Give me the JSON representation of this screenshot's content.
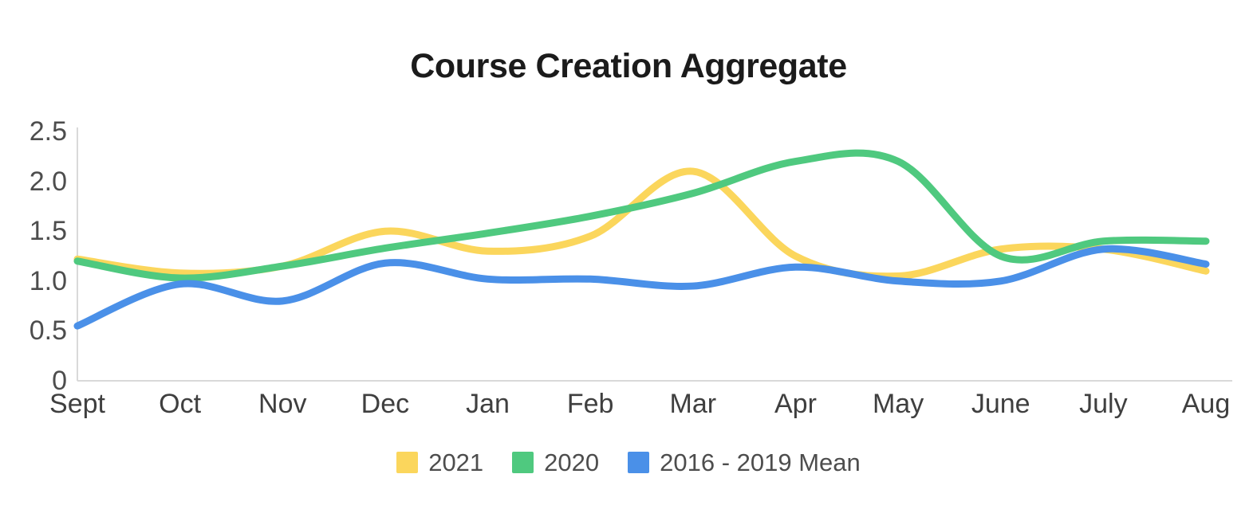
{
  "chart": {
    "title": "Course Creation Aggregate"
  },
  "legend": {
    "items": [
      {
        "label": "2021",
        "color": "#FBD65C"
      },
      {
        "label": "2020",
        "color": "#4FC97F"
      },
      {
        "label": "2016 - 2019 Mean",
        "color": "#4A90E8"
      }
    ]
  },
  "axes": {
    "y_ticks": [
      "2.5",
      "2.0",
      "1.5",
      "1.0",
      "0.5",
      "0"
    ],
    "x_ticks": [
      "Sept",
      "Oct",
      "Nov",
      "Dec",
      "Jan",
      "Feb",
      "Mar",
      "Apr",
      "May",
      "June",
      "July",
      "Aug"
    ]
  },
  "chart_data": {
    "type": "line",
    "title": "Course Creation Aggregate",
    "xlabel": "",
    "ylabel": "",
    "categories": [
      "Sept",
      "Oct",
      "Nov",
      "Dec",
      "Jan",
      "Feb",
      "Mar",
      "Apr",
      "May",
      "June",
      "July",
      "Aug"
    ],
    "ylim": [
      0,
      2.5
    ],
    "yticks": [
      0,
      0.5,
      1.0,
      1.5,
      2.0,
      2.5
    ],
    "grid": false,
    "legend_position": "bottom",
    "smoothing": "spline",
    "series": [
      {
        "name": "2021",
        "color": "#FBD65C",
        "values": [
          1.22,
          1.08,
          1.15,
          1.5,
          1.3,
          1.45,
          2.1,
          1.25,
          1.05,
          1.32,
          1.32,
          1.1
        ]
      },
      {
        "name": "2020",
        "color": "#4FC97F",
        "values": [
          1.2,
          1.03,
          1.15,
          1.33,
          1.48,
          1.65,
          1.88,
          2.2,
          2.2,
          1.25,
          1.4,
          1.4
        ]
      },
      {
        "name": "2016 - 2019 Mean",
        "color": "#4A90E8",
        "values": [
          0.55,
          0.97,
          0.8,
          1.18,
          1.02,
          1.02,
          0.95,
          1.14,
          1.0,
          1.0,
          1.32,
          1.17
        ]
      }
    ]
  }
}
